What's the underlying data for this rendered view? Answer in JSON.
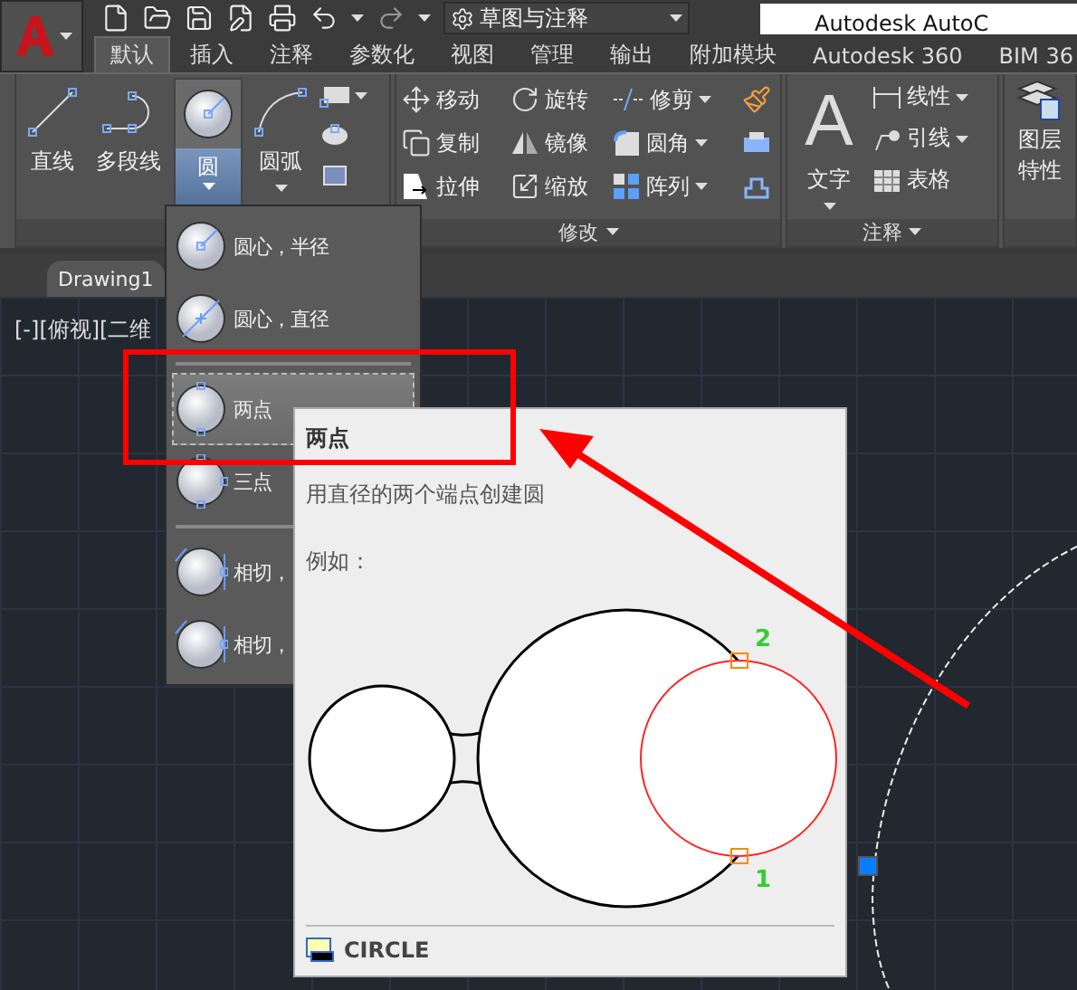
{
  "quick_access": {
    "workspace": "草图与注释"
  },
  "title": "Autodesk AutoC",
  "tabs": [
    {
      "label": "默认",
      "selected": true
    },
    {
      "label": "插入",
      "selected": false
    },
    {
      "label": "注释",
      "selected": false
    },
    {
      "label": "参数化",
      "selected": false
    },
    {
      "label": "视图",
      "selected": false
    },
    {
      "label": "管理",
      "selected": false
    },
    {
      "label": "输出",
      "selected": false
    },
    {
      "label": "附加模块",
      "selected": false
    },
    {
      "label": "Autodesk 360",
      "selected": false
    },
    {
      "label": "BIM 36",
      "selected": false
    }
  ],
  "draw_panel": {
    "tools": [
      {
        "kind": "line",
        "label": "直线",
        "active": false
      },
      {
        "kind": "polyline",
        "label": "多段线",
        "active": false
      },
      {
        "kind": "circle",
        "label": "圆",
        "active": true
      },
      {
        "kind": "arc",
        "label": "圆弧",
        "active": false
      }
    ]
  },
  "modify_panel": {
    "label": "修改",
    "tools": [
      {
        "kind": "move",
        "label": "移动"
      },
      {
        "kind": "rotate",
        "label": "旋转"
      },
      {
        "kind": "trim",
        "label": "修剪"
      },
      {
        "kind": "copy",
        "label": "复制"
      },
      {
        "kind": "mirror",
        "label": "镜像"
      },
      {
        "kind": "fillet",
        "label": "圆角"
      },
      {
        "kind": "stretch",
        "label": "拉伸"
      },
      {
        "kind": "scale",
        "label": "缩放"
      },
      {
        "kind": "array",
        "label": "阵列"
      }
    ]
  },
  "annotation_panel": {
    "label": "注释",
    "text_tool": {
      "glyph": "A",
      "label": "文字"
    },
    "tools": [
      {
        "kind": "linear",
        "label": "线性"
      },
      {
        "kind": "leader",
        "label": "引线"
      },
      {
        "kind": "table",
        "label": "表格"
      }
    ]
  },
  "layers_panel": {
    "label_lines": [
      "图层",
      "特性"
    ]
  },
  "document_tab": "Drawing1",
  "viewport_label": "[-][俯视][二维",
  "circle_menu": [
    {
      "kind": "center-radius",
      "label": "圆心，半径",
      "selected": false,
      "separator_before": false
    },
    {
      "kind": "center-diameter",
      "label": "圆心，直径",
      "selected": false,
      "separator_before": false
    },
    {
      "kind": "two-point",
      "label": "两点",
      "selected": true,
      "separator_before": true
    },
    {
      "kind": "three-point",
      "label": "三点",
      "selected": false,
      "separator_before": false
    },
    {
      "kind": "tan-tan-radius",
      "label": "相切，",
      "selected": false,
      "separator_before": true
    },
    {
      "kind": "tan-tan-tan",
      "label": "相切，",
      "selected": false,
      "separator_before": false
    }
  ],
  "tooltip": {
    "title": "两点",
    "description": "用直径的两个端点创建圆",
    "example_label": "例如：",
    "point_labels": [
      "2",
      "1"
    ],
    "command": "CIRCLE"
  }
}
